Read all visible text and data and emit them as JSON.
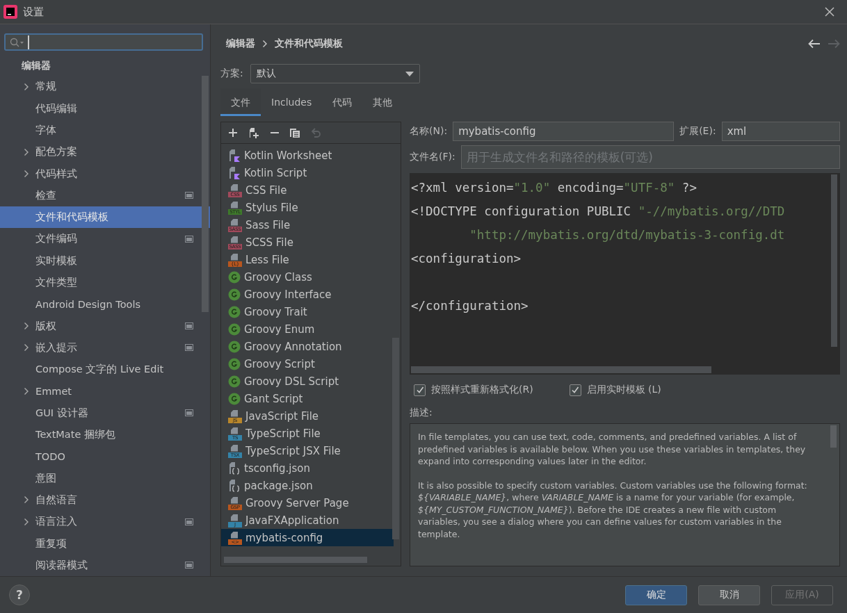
{
  "window": {
    "title": "设置"
  },
  "sidebar": {
    "header": "编辑器",
    "items": [
      {
        "label": "常规",
        "expandable": true,
        "project_badge": false,
        "selected": false
      },
      {
        "label": "代码编辑",
        "expandable": false,
        "project_badge": false,
        "selected": false
      },
      {
        "label": "字体",
        "expandable": false,
        "project_badge": false,
        "selected": false
      },
      {
        "label": "配色方案",
        "expandable": true,
        "project_badge": false,
        "selected": false
      },
      {
        "label": "代码样式",
        "expandable": true,
        "project_badge": false,
        "selected": false
      },
      {
        "label": "检查",
        "expandable": false,
        "project_badge": true,
        "selected": false
      },
      {
        "label": "文件和代码模板",
        "expandable": false,
        "project_badge": false,
        "selected": true
      },
      {
        "label": "文件编码",
        "expandable": false,
        "project_badge": true,
        "selected": false
      },
      {
        "label": "实时模板",
        "expandable": false,
        "project_badge": false,
        "selected": false
      },
      {
        "label": "文件类型",
        "expandable": false,
        "project_badge": false,
        "selected": false
      },
      {
        "label": "Android Design Tools",
        "expandable": false,
        "project_badge": false,
        "selected": false
      },
      {
        "label": "版权",
        "expandable": true,
        "project_badge": true,
        "selected": false
      },
      {
        "label": "嵌入提示",
        "expandable": true,
        "project_badge": true,
        "selected": false
      },
      {
        "label": "Compose 文字的 Live Edit",
        "expandable": false,
        "project_badge": false,
        "selected": false
      },
      {
        "label": "Emmet",
        "expandable": true,
        "project_badge": false,
        "selected": false
      },
      {
        "label": "GUI 设计器",
        "expandable": false,
        "project_badge": true,
        "selected": false
      },
      {
        "label": "TextMate 捆绑包",
        "expandable": false,
        "project_badge": false,
        "selected": false
      },
      {
        "label": "TODO",
        "expandable": false,
        "project_badge": false,
        "selected": false
      },
      {
        "label": "意图",
        "expandable": false,
        "project_badge": false,
        "selected": false
      },
      {
        "label": "自然语言",
        "expandable": true,
        "project_badge": false,
        "selected": false
      },
      {
        "label": "语言注入",
        "expandable": true,
        "project_badge": true,
        "selected": false
      },
      {
        "label": "重复项",
        "expandable": false,
        "project_badge": false,
        "selected": false
      },
      {
        "label": "阅读器模式",
        "expandable": false,
        "project_badge": true,
        "selected": false
      }
    ]
  },
  "breadcrumb": [
    "编辑器",
    "文件和代码模板"
  ],
  "scheme": {
    "label": "方案:",
    "value": "默认"
  },
  "tabs": [
    {
      "label": "文件",
      "selected": true
    },
    {
      "label": "Includes",
      "selected": false
    },
    {
      "label": "代码",
      "selected": false
    },
    {
      "label": "其他",
      "selected": false
    }
  ],
  "templates": [
    {
      "name": "Kotlin Worksheet",
      "kind": "kotlin",
      "selected": false
    },
    {
      "name": "Kotlin Script",
      "kind": "kotlin",
      "selected": false
    },
    {
      "name": "CSS File",
      "kind": "badge",
      "badge": "CSS",
      "color": "#a0495b",
      "selected": false
    },
    {
      "name": "Stylus File",
      "kind": "badge",
      "badge": "STYL",
      "color": "#3e7a2b",
      "selected": false
    },
    {
      "name": "Sass File",
      "kind": "badge",
      "badge": "SASS",
      "color": "#a0495b",
      "selected": false
    },
    {
      "name": "SCSS File",
      "kind": "badge",
      "badge": "SASS",
      "color": "#a0495b",
      "selected": false
    },
    {
      "name": "Less File",
      "kind": "badge",
      "badge": "{L}",
      "color": "#b8561e",
      "selected": false
    },
    {
      "name": "Groovy Class",
      "kind": "groovy",
      "selected": false
    },
    {
      "name": "Groovy Interface",
      "kind": "groovy",
      "selected": false
    },
    {
      "name": "Groovy Trait",
      "kind": "groovy",
      "selected": false
    },
    {
      "name": "Groovy Enum",
      "kind": "groovy",
      "selected": false
    },
    {
      "name": "Groovy Annotation",
      "kind": "groovy",
      "selected": false
    },
    {
      "name": "Groovy Script",
      "kind": "groovy",
      "selected": false
    },
    {
      "name": "Groovy DSL Script",
      "kind": "groovy",
      "selected": false
    },
    {
      "name": "Gant Script",
      "kind": "groovy",
      "selected": false
    },
    {
      "name": "JavaScript File",
      "kind": "badge",
      "badge": "JS",
      "color": "#b8862b",
      "selected": false
    },
    {
      "name": "TypeScript File",
      "kind": "badge",
      "badge": "TS",
      "color": "#3483a8",
      "selected": false
    },
    {
      "name": "TypeScript JSX File",
      "kind": "badge",
      "badge": "TSX",
      "color": "#3483a8",
      "selected": false
    },
    {
      "name": "tsconfig.json",
      "kind": "json",
      "selected": false
    },
    {
      "name": "package.json",
      "kind": "json",
      "selected": false
    },
    {
      "name": "Groovy Server Page",
      "kind": "badge",
      "badge": "GSP",
      "color": "#b8561e",
      "selected": false
    },
    {
      "name": "JavaFXApplication",
      "kind": "badge",
      "badge": "J",
      "color": "#3483a8",
      "selected": false
    },
    {
      "name": "mybatis-config",
      "kind": "badge",
      "badge": "<>",
      "color": "#b8561e",
      "selected": true
    }
  ],
  "name_field": {
    "label": "名称(N):",
    "value": "mybatis-config"
  },
  "extension_field": {
    "label": "扩展(E):",
    "value": "xml"
  },
  "filename_field": {
    "label": "文件名(F):",
    "placeholder": "用于生成文件名和路径的模板(可选)"
  },
  "code_lines": [
    {
      "lines": [
        [
          {
            "kind": "tag",
            "text": "<?xml version="
          },
          {
            "kind": "string",
            "text": "\"1.0\""
          },
          {
            "kind": "tag",
            "text": " encoding="
          },
          {
            "kind": "string",
            "text": "\"UTF-8\""
          },
          {
            "kind": "tag",
            "text": " ?>"
          }
        ],
        [
          {
            "kind": "tag",
            "text": "<!DOCTYPE configuration PUBLIC "
          },
          {
            "kind": "string",
            "text": "\"-//mybatis.org//DTD"
          }
        ],
        [
          {
            "kind": "string",
            "text": "        \"http://mybatis.org/dtd/mybatis-3-config.dt"
          }
        ],
        [
          {
            "kind": "tag",
            "text": "<configuration>"
          }
        ]
      ]
    },
    {
      "lines": [
        [
          {
            "kind": "tag",
            "text": "</configuration>"
          }
        ]
      ]
    }
  ],
  "options": [
    {
      "label": "按照样式重新格式化(R)",
      "checked": true
    },
    {
      "label": "启用实时模板 (L)",
      "checked": true
    }
  ],
  "description": {
    "label": "描述:",
    "paragraphs": [
      "In file templates, you can use text, code, comments, and predefined variables. A list of predefined variables is available below. When you use these variables in templates, they expand into corresponding values later in the editor.",
      "It is also possible to specify custom variables. Custom variables use the following format: *${VARIABLE_NAME}*, where *VARIABLE_NAME* is a name for your variable (for example, *${MY_CUSTOM_FUNCTION_NAME}*). Before the IDE creates a new file with custom variables, you see a dialog where you can define values for custom variables in the template."
    ]
  },
  "buttons": [
    {
      "label": "确定",
      "kind": "primary"
    },
    {
      "label": "取消",
      "kind": "normal"
    },
    {
      "label": "应用(A)",
      "kind": "disabled"
    }
  ],
  "help": {
    "label": "?"
  }
}
